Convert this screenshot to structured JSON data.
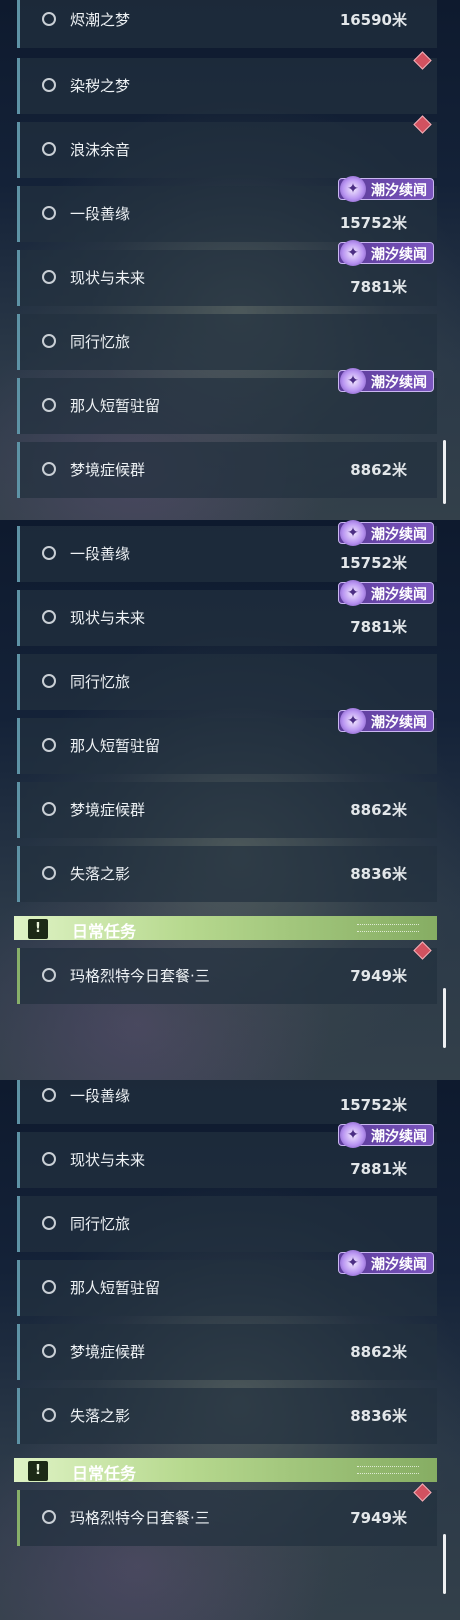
{
  "tag_label": "潮汐续闻",
  "tag_icon": "swirl-icon",
  "section": {
    "title": "日常任务",
    "icon": "exclamation-icon"
  },
  "quests": {
    "q1": {
      "name": "烬潮之梦",
      "distance": "16590米"
    },
    "q2": {
      "name": "染秽之梦"
    },
    "q3": {
      "name": "浪沫余音"
    },
    "q4": {
      "name": "一段善缘",
      "distance": "15752米"
    },
    "q5": {
      "name": "现状与未来",
      "distance": "7881米"
    },
    "q6": {
      "name": "同行忆旅"
    },
    "q7": {
      "name": "那人短暂驻留"
    },
    "q8": {
      "name": "梦境症候群",
      "distance": "8862米"
    },
    "q9": {
      "name": "失落之影",
      "distance": "8836米"
    },
    "d1": {
      "name": "玛格烈特今日套餐·三",
      "distance": "7949米"
    }
  },
  "colors": {
    "tag_purple": "#6b47b0",
    "daily_green": "#9cc878",
    "quest_teal": "#5e93a6",
    "marker_red": "#d25260"
  }
}
